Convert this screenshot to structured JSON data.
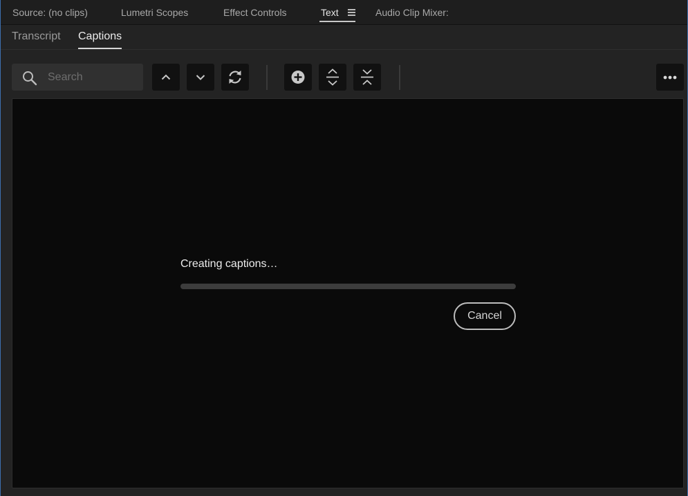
{
  "panel_tabs": [
    {
      "label": "Source: (no clips)",
      "active": false
    },
    {
      "label": "Lumetri Scopes",
      "active": false
    },
    {
      "label": "Effect Controls",
      "active": false
    },
    {
      "label": "Text",
      "active": true
    },
    {
      "label": "Audio Clip Mixer:",
      "active": false
    }
  ],
  "panel_menu_icon": "hamburger-menu-icon",
  "subtabs": [
    {
      "label": "Transcript",
      "active": false
    },
    {
      "label": "Captions",
      "active": true
    }
  ],
  "toolbar": {
    "search_placeholder": "Search",
    "search_icon": "search-icon",
    "buttons": [
      {
        "icon": "chevron-up-icon"
      },
      {
        "icon": "chevron-down-icon"
      },
      {
        "icon": "refresh-icon"
      },
      {
        "icon": "add-circle-icon"
      },
      {
        "icon": "split-caption-icon"
      },
      {
        "icon": "merge-caption-icon"
      },
      {
        "icon": "more-options-icon"
      }
    ]
  },
  "progress": {
    "status": "Creating captions…",
    "value": 0,
    "cancel_label": "Cancel"
  },
  "colors": {
    "accent_border": "#3d6fae",
    "panel_bg": "#232323",
    "content_bg": "#0a0a0a"
  }
}
